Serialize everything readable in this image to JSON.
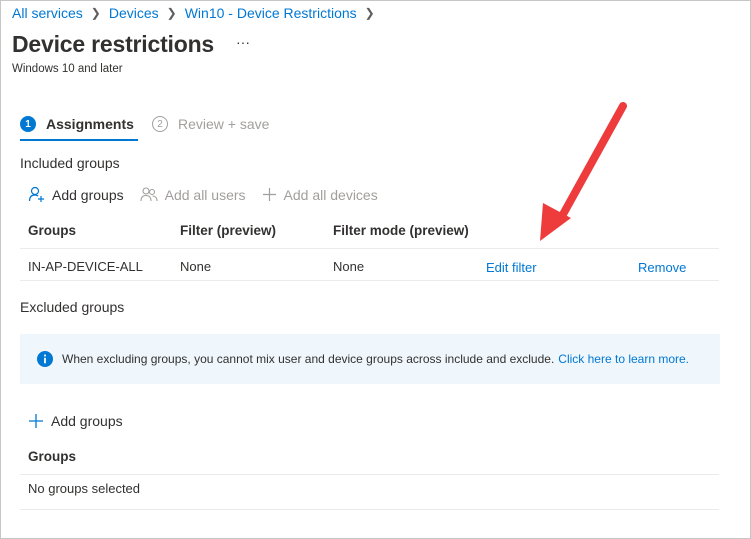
{
  "breadcrumb": [
    "All services",
    "Devices",
    "Win10 - Device Restrictions"
  ],
  "page": {
    "title": "Device restrictions",
    "more": "···",
    "subtitle": "Windows 10 and later"
  },
  "steps": [
    {
      "num": "1",
      "label": "Assignments",
      "state": "active"
    },
    {
      "num": "2",
      "label": "Review + save",
      "state": "inactive"
    }
  ],
  "included": {
    "label": "Included groups",
    "actions": {
      "add_groups": "Add groups",
      "add_all_users": "Add all users",
      "add_all_devices": "Add all devices"
    },
    "columns": {
      "groups": "Groups",
      "filter": "Filter (preview)",
      "filter_mode": "Filter mode (preview)"
    },
    "row": {
      "group": "IN-AP-DEVICE-ALL",
      "filter": "None",
      "filter_mode": "None",
      "edit_filter": "Edit filter",
      "remove": "Remove"
    }
  },
  "excluded": {
    "label": "Excluded groups",
    "info_text": "When excluding groups, you cannot mix user and device groups across include and exclude.",
    "info_link": "Click here to learn more.",
    "add_groups": "Add groups",
    "column_groups": "Groups",
    "empty_text": "No groups selected"
  },
  "colors": {
    "accent": "#0078d4",
    "annotation_arrow": "#ee3b3b",
    "info_background": "#eff6fc"
  },
  "icons": {
    "info": "info-circle-icon",
    "add_groups": "person-add-icon",
    "add_all_users": "people-icon",
    "plus": "plus-icon",
    "chevron": "chevron-right-icon"
  }
}
